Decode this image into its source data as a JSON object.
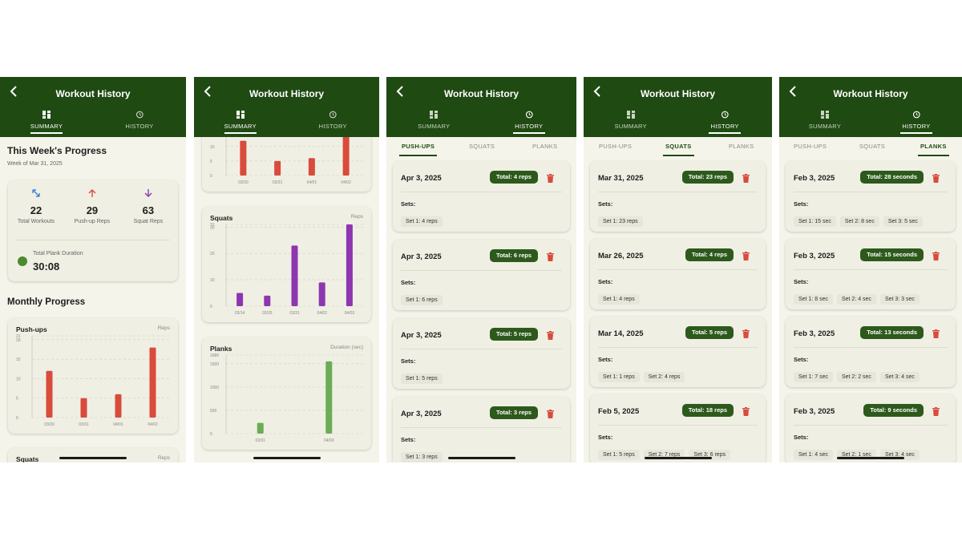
{
  "app": {
    "title": "Workout History",
    "tabs": {
      "summary": "SUMMARY",
      "history": "HISTORY"
    },
    "subtabs": {
      "pushups": "PUSH-UPS",
      "squats": "SQUATS",
      "planks": "PLANKS"
    },
    "sets_label": "Sets:"
  },
  "colors": {
    "header": "#1f4a12",
    "pushups": "#d94b3b",
    "squats": "#8e35b0",
    "planks": "#6aad54",
    "badge": "#2d5a1c"
  },
  "summary": {
    "heading": "This Week's Progress",
    "week_of": "Week of Mar 31, 2025",
    "stats": [
      {
        "icon": "expand-arrows-icon",
        "value": "22",
        "label": "Total Workouts"
      },
      {
        "icon": "arrow-up-icon",
        "value": "29",
        "label": "Push-up Reps"
      },
      {
        "icon": "arrow-down-icon",
        "value": "63",
        "label": "Squat Reps"
      }
    ],
    "plank_label": "Total Plank Duration",
    "plank_value": "30:08",
    "monthly_heading": "Monthly Progress",
    "squats_title_peek": "Squats",
    "squats_unit_peek": "Reps"
  },
  "chart_data": [
    {
      "type": "bar",
      "title": "Push-ups",
      "ylabel": "Reps",
      "categories": [
        "03/30",
        "03/31",
        "04/01",
        "04/02"
      ],
      "values": [
        12,
        5,
        6,
        18
      ],
      "ylim": [
        0,
        21
      ],
      "yticks": [
        0,
        5,
        10,
        15,
        20,
        21
      ],
      "color": "#d94b3b"
    },
    {
      "type": "bar",
      "title": "Squats",
      "ylabel": "Reps",
      "categories": [
        "03/14",
        "03/26",
        "03/31",
        "04/02",
        "04/03"
      ],
      "values": [
        5,
        4,
        23,
        9,
        31
      ],
      "ylim": [
        0,
        31
      ],
      "yticks": [
        0,
        10,
        20,
        30,
        31
      ],
      "color": "#8e35b0"
    },
    {
      "type": "bar",
      "title": "Planks",
      "ylabel": "Duration (sec)",
      "categories": [
        "03/31",
        "04/03"
      ],
      "values": [
        230,
        1550
      ],
      "ylim": [
        0,
        1686
      ],
      "yticks": [
        0,
        500,
        1000,
        1500,
        1686
      ],
      "color": "#6aad54"
    }
  ],
  "pushups_entries": [
    {
      "date": "Apr 3, 2025",
      "total": "Total: 4 reps",
      "sets": [
        "Set 1: 4 reps"
      ]
    },
    {
      "date": "Apr 3, 2025",
      "total": "Total: 6 reps",
      "sets": [
        "Set 1: 6 reps"
      ]
    },
    {
      "date": "Apr 3, 2025",
      "total": "Total: 5 reps",
      "sets": [
        "Set 1: 5 reps"
      ]
    },
    {
      "date": "Apr 3, 2025",
      "total": "Total: 3 reps",
      "sets": [
        "Set 1: 3 reps"
      ]
    }
  ],
  "squats_entries": [
    {
      "date": "Mar 31, 2025",
      "total": "Total: 23 reps",
      "sets": [
        "Set 1: 23 reps"
      ]
    },
    {
      "date": "Mar 26, 2025",
      "total": "Total: 4 reps",
      "sets": [
        "Set 1: 4 reps"
      ]
    },
    {
      "date": "Mar 14, 2025",
      "total": "Total: 5 reps",
      "sets": [
        "Set 1: 1 reps",
        "Set 2: 4 reps"
      ]
    },
    {
      "date": "Feb 5, 2025",
      "total": "Total: 18 reps",
      "sets": [
        "Set 1: 5 reps",
        "Set 2: 7 reps",
        "Set 3: 6 reps"
      ]
    }
  ],
  "planks_entries": [
    {
      "date": "Feb 3, 2025",
      "total": "Total: 28 seconds",
      "sets": [
        "Set 1: 15 sec",
        "Set 2: 8 sec",
        "Set 3: 5 sec"
      ]
    },
    {
      "date": "Feb 3, 2025",
      "total": "Total: 15 seconds",
      "sets": [
        "Set 1: 8 sec",
        "Set 2: 4 sec",
        "Set 3: 3 sec"
      ]
    },
    {
      "date": "Feb 3, 2025",
      "total": "Total: 13 seconds",
      "sets": [
        "Set 1: 7 sec",
        "Set 2: 2 sec",
        "Set 3: 4 sec"
      ]
    },
    {
      "date": "Feb 3, 2025",
      "total": "Total: 9 seconds",
      "sets": [
        "Set 1: 4 sec",
        "Set 2: 1 sec",
        "Set 3: 4 sec"
      ]
    }
  ]
}
